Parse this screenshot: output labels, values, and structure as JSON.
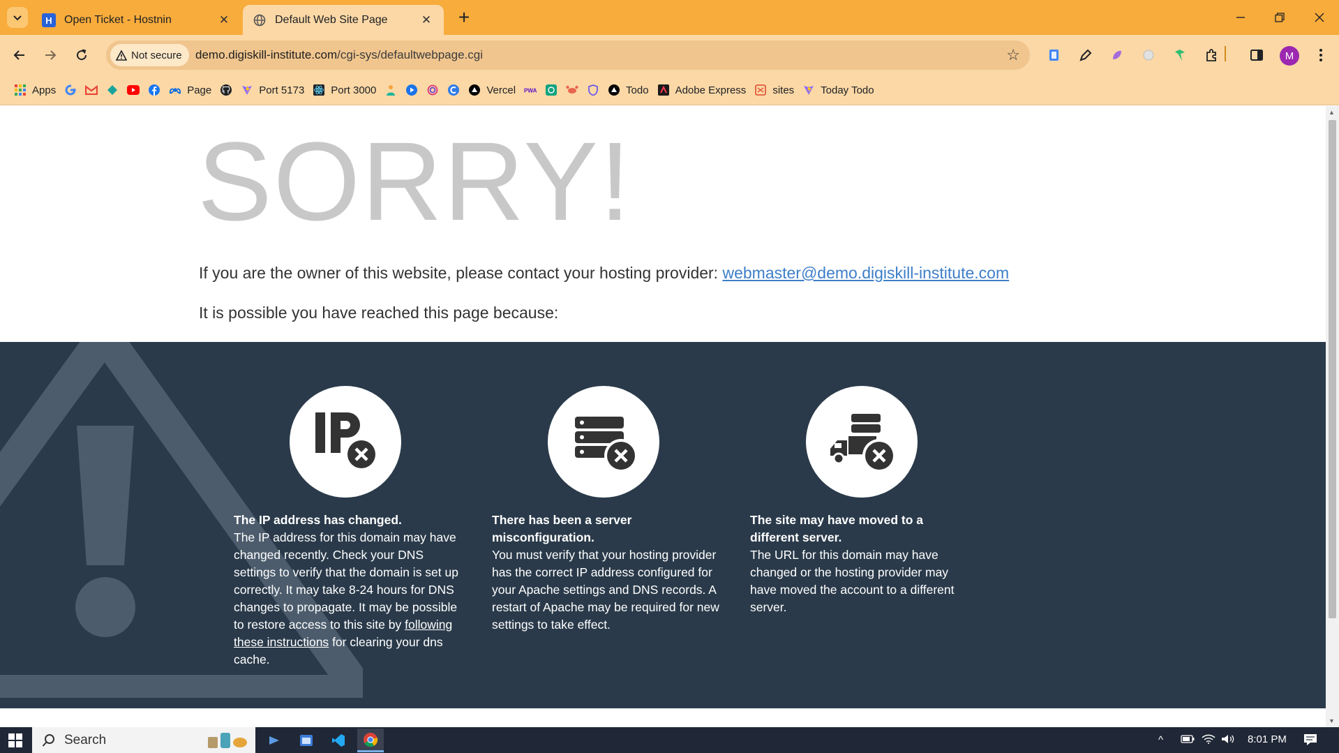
{
  "tabs": [
    {
      "title": "Open Ticket - Hostnin",
      "favicon": "hostnin-h-icon",
      "active": false
    },
    {
      "title": "Default Web Site Page",
      "favicon": "globe-icon",
      "active": true
    }
  ],
  "address_bar": {
    "security_label": "Not secure",
    "url_host": "demo.digiskill-institute.com",
    "url_path": "/cgi-sys/defaultwebpage.cgi"
  },
  "profile_initial": "M",
  "bookmarks": [
    {
      "label": "Apps",
      "icon": "apps-grid-icon"
    },
    {
      "label": "",
      "icon": "google-icon"
    },
    {
      "label": "",
      "icon": "gmail-icon"
    },
    {
      "label": "",
      "icon": "diamond-icon"
    },
    {
      "label": "",
      "icon": "youtube-icon"
    },
    {
      "label": "",
      "icon": "facebook-icon"
    },
    {
      "label": "Page",
      "icon": "meta-icon"
    },
    {
      "label": "",
      "icon": "github-icon"
    },
    {
      "label": "Port 5173",
      "icon": "vite-icon"
    },
    {
      "label": "Port 3000",
      "icon": "react-icon"
    },
    {
      "label": "",
      "icon": "person-icon"
    },
    {
      "label": "",
      "icon": "play-icon"
    },
    {
      "label": "",
      "icon": "spiral-icon"
    },
    {
      "label": "",
      "icon": "c-icon"
    },
    {
      "label": "Vercel",
      "icon": "vercel-icon"
    },
    {
      "label": "",
      "icon": "pwa-icon"
    },
    {
      "label": "",
      "icon": "chatgpt-icon"
    },
    {
      "label": "",
      "icon": "crab-icon"
    },
    {
      "label": "",
      "icon": "shield-icon"
    },
    {
      "label": "Todo",
      "icon": "vercel-icon"
    },
    {
      "label": "Adobe Express",
      "icon": "adobe-icon"
    },
    {
      "label": "sites",
      "icon": "sites-icon"
    },
    {
      "label": "Today Todo",
      "icon": "vite-icon"
    }
  ],
  "page": {
    "heading": "SORRY!",
    "contact_text": "If you are the owner of this website, please contact your hosting provider:",
    "contact_email": "webmaster@demo.digiskill-institute.com",
    "reason_intro": "It is possible you have reached this page because:",
    "reasons": [
      {
        "icon": "ip-changed-icon",
        "title": "The IP address has changed.",
        "text_before_link": "The IP address for this domain may have changed recently. Check your DNS settings to verify that the domain is set up correctly. It may take 8-24 hours for DNS changes to propagate. It may be possible to restore access to this site by",
        "link": "following these instructions",
        "text_after_link": "for clearing your dns cache."
      },
      {
        "icon": "server-error-icon",
        "title": "There has been a server misconfiguration.",
        "text_before_link": "You must verify that your hosting provider has the correct IP address configured for your Apache settings and DNS records. A restart of Apache may be required for new settings to take effect.",
        "link": "",
        "text_after_link": ""
      },
      {
        "icon": "server-moved-icon",
        "title": "The site may have moved to a different server.",
        "text_before_link": "The URL for this domain may have changed or the hosting provider may have moved the account to a different server.",
        "link": "",
        "text_after_link": ""
      }
    ]
  },
  "taskbar": {
    "search_label": "Search",
    "clock": "8:01 PM"
  },
  "colors": {
    "tab_strip": "#f8ac3c",
    "toolbar": "#fbd8a6",
    "panel": "#2a3a4a",
    "heading": "#c8c8c8",
    "link": "#3d7ec8"
  }
}
